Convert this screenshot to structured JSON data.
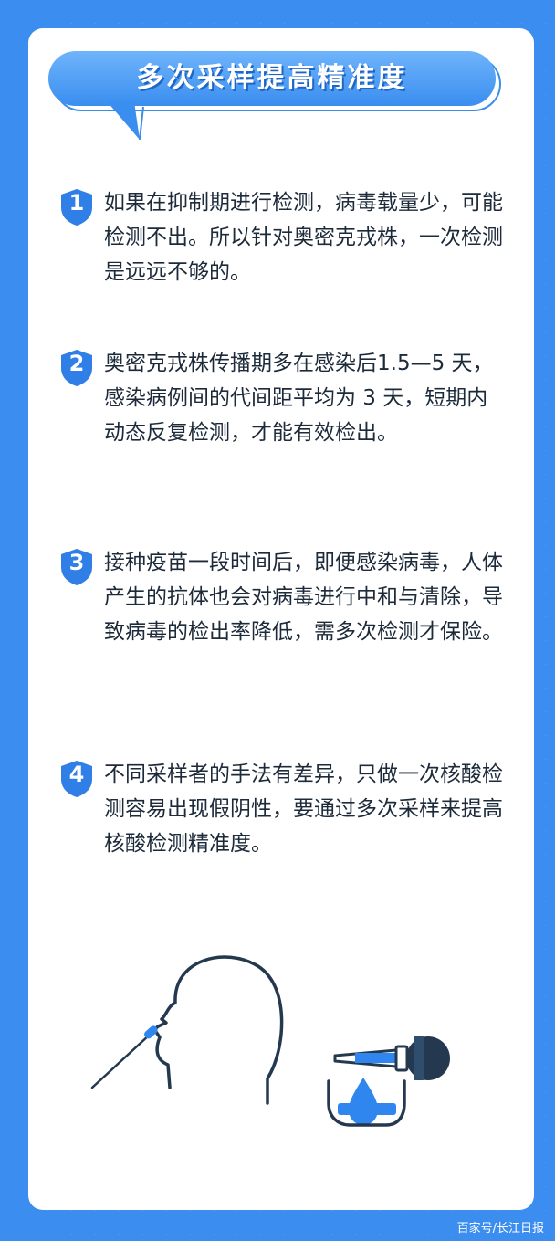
{
  "title": "多次采样提高精准度",
  "items": [
    {
      "num": "1",
      "text": "如果在抑制期进行检测，病毒载量少，可能检测不出。所以针对奥密克戎株，一次检测是远远不够的。"
    },
    {
      "num": "2",
      "text": "奥密克戎株传播期多在感染后1.5—5 天，感染病例间的代间距平均为 3 天，短期内动态反复检测，才能有效检出。"
    },
    {
      "num": "3",
      "text": "接种疫苗一段时间后，即便感染病毒，人体产生的抗体也会对病毒进行中和与清除，导致病毒的检出率降低，需多次检测才保险。"
    },
    {
      "num": "4",
      "text": "不同采样者的手法有差异，只做一次核酸检测容易出现假阴性，要通过多次采样来提高核酸检测精准度。"
    }
  ],
  "footer": "百家号/长江日报",
  "colors": {
    "background": "#3b8ef0",
    "accent": "#2f7fe6",
    "ink": "#1d2a3a"
  },
  "icons": [
    "shield-number-icon",
    "nasal-swab-head-icon",
    "dropper-icon",
    "droplet-icon",
    "beaker-icon"
  ]
}
